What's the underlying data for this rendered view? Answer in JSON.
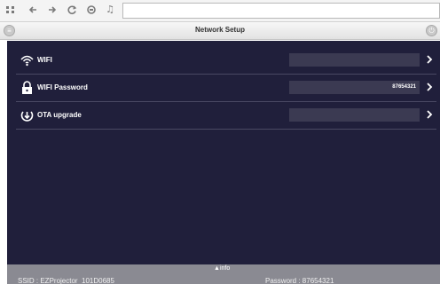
{
  "browser": {
    "url": "",
    "icons": [
      "apps-icon",
      "back-icon",
      "forward-icon",
      "reload-icon",
      "stop-icon",
      "music-icon"
    ]
  },
  "header": {
    "title": "Network Setup",
    "left_icon": "menu-circle-icon",
    "right_icon": "power-circle-icon"
  },
  "rows": [
    {
      "label": "WIFI",
      "value": "",
      "icon": "wifi-icon"
    },
    {
      "label": "WIFI Password",
      "value": "87654321",
      "icon": "lock-icon"
    },
    {
      "label": "OTA upgrade",
      "value": "",
      "icon": "upgrade-icon"
    }
  ],
  "info": {
    "toggle": "info",
    "ssid": "SSID : EZProjector_101D0685",
    "password": "Password : 87654321"
  },
  "colors": {
    "main_bg": "#201f3b",
    "field_bg": "#3b3a52",
    "divider": "#4a4963",
    "info_bar": "#8a8a92"
  }
}
